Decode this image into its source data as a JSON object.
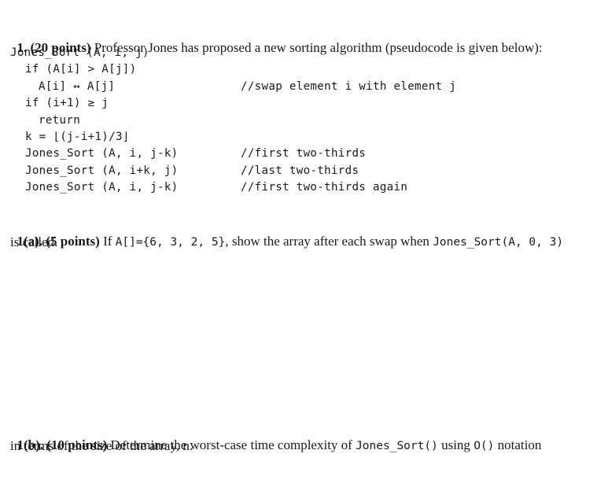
{
  "question1": {
    "number": "1.",
    "points": "(20 points)",
    "intro": " Professor Jones has proposed a new sorting algorithm (pseudocode is given below):"
  },
  "pseudocode": {
    "lines": [
      {
        "indent": 0,
        "code": "Jones_Sort (A, i, j)",
        "comment": ""
      },
      {
        "indent": 1,
        "code": "if (A[i] > A[j])",
        "comment": ""
      },
      {
        "indent": 2,
        "code": "A[i] ↔ A[j]",
        "comment": "//swap element i with element j"
      },
      {
        "indent": 1,
        "code": "if (i+1) ≥ j",
        "comment": ""
      },
      {
        "indent": 2,
        "code": "return",
        "comment": ""
      },
      {
        "indent": 1,
        "code": "k = ⌊(j-i+1)/3⌋",
        "comment": ""
      },
      {
        "indent": 1,
        "code": "Jones_Sort (A, i, j-k)",
        "comment": "//first two-thirds"
      },
      {
        "indent": 1,
        "code": "Jones_Sort (A, i+k, j)",
        "comment": "//last two-thirds"
      },
      {
        "indent": 1,
        "code": "Jones_Sort (A, i, j-k)",
        "comment": "//first two-thirds again"
      }
    ]
  },
  "part_a": {
    "label": "1(a).",
    "points": "(5 points)",
    "text_before": " If ",
    "array_code": "A[]={6, 3, 2, 5}",
    "text_middle": ", show the array after each swap when ",
    "call_code": "Jones_Sort(A, 0, 3)",
    "line2": "is called."
  },
  "part_b": {
    "label": "1(b).",
    "points": "(10 points)",
    "text_before": " Determine the worst-case time complexity of ",
    "func_code": "Jones_Sort()",
    "text_middle": " using ",
    "notation_code": "O()",
    "text_after": " notation",
    "line2": "in terms of the size of the array, n."
  }
}
